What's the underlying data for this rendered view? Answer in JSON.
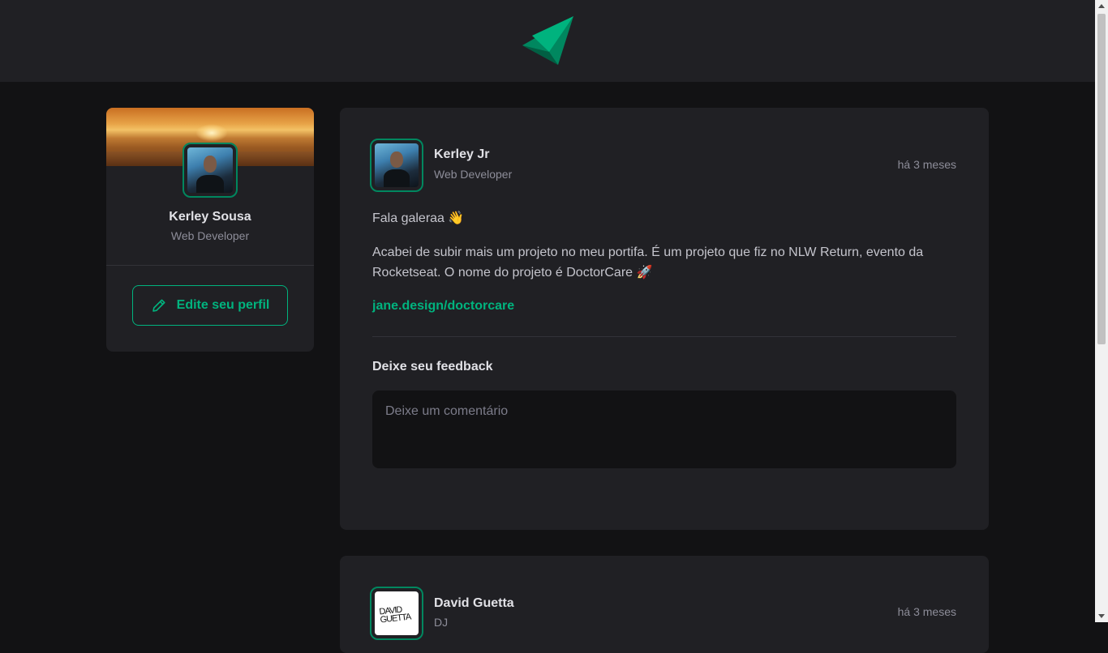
{
  "colors": {
    "accent": "#00b37e",
    "accent_border": "#00875f",
    "background": "#121214",
    "card": "#202024",
    "text_muted": "#8d8d99"
  },
  "header": {
    "logo_icon": "paper-plane-logo-icon"
  },
  "sidebar": {
    "name": "Kerley Sousa",
    "role": "Web Developer",
    "edit_button_label": "Edite seu perfil",
    "edit_icon": "pencil-icon"
  },
  "posts": [
    {
      "author": "Kerley Jr",
      "role": "Web Developer",
      "time": "há 3 meses",
      "paragraphs": [
        "Fala galeraa 👋",
        "Acabei de subir mais um projeto no meu portifa. É um projeto que fiz no NLW Return, evento da Rocketseat. O nome do projeto é DoctorCare 🚀"
      ],
      "link": "jane.design/doctorcare",
      "feedback_title": "Deixe seu feedback",
      "comment_placeholder": "Deixe um comentário"
    },
    {
      "author": "David Guetta",
      "role": "DJ",
      "time": "há 3 meses",
      "avatar_text": "DAVID GUETTA"
    }
  ]
}
